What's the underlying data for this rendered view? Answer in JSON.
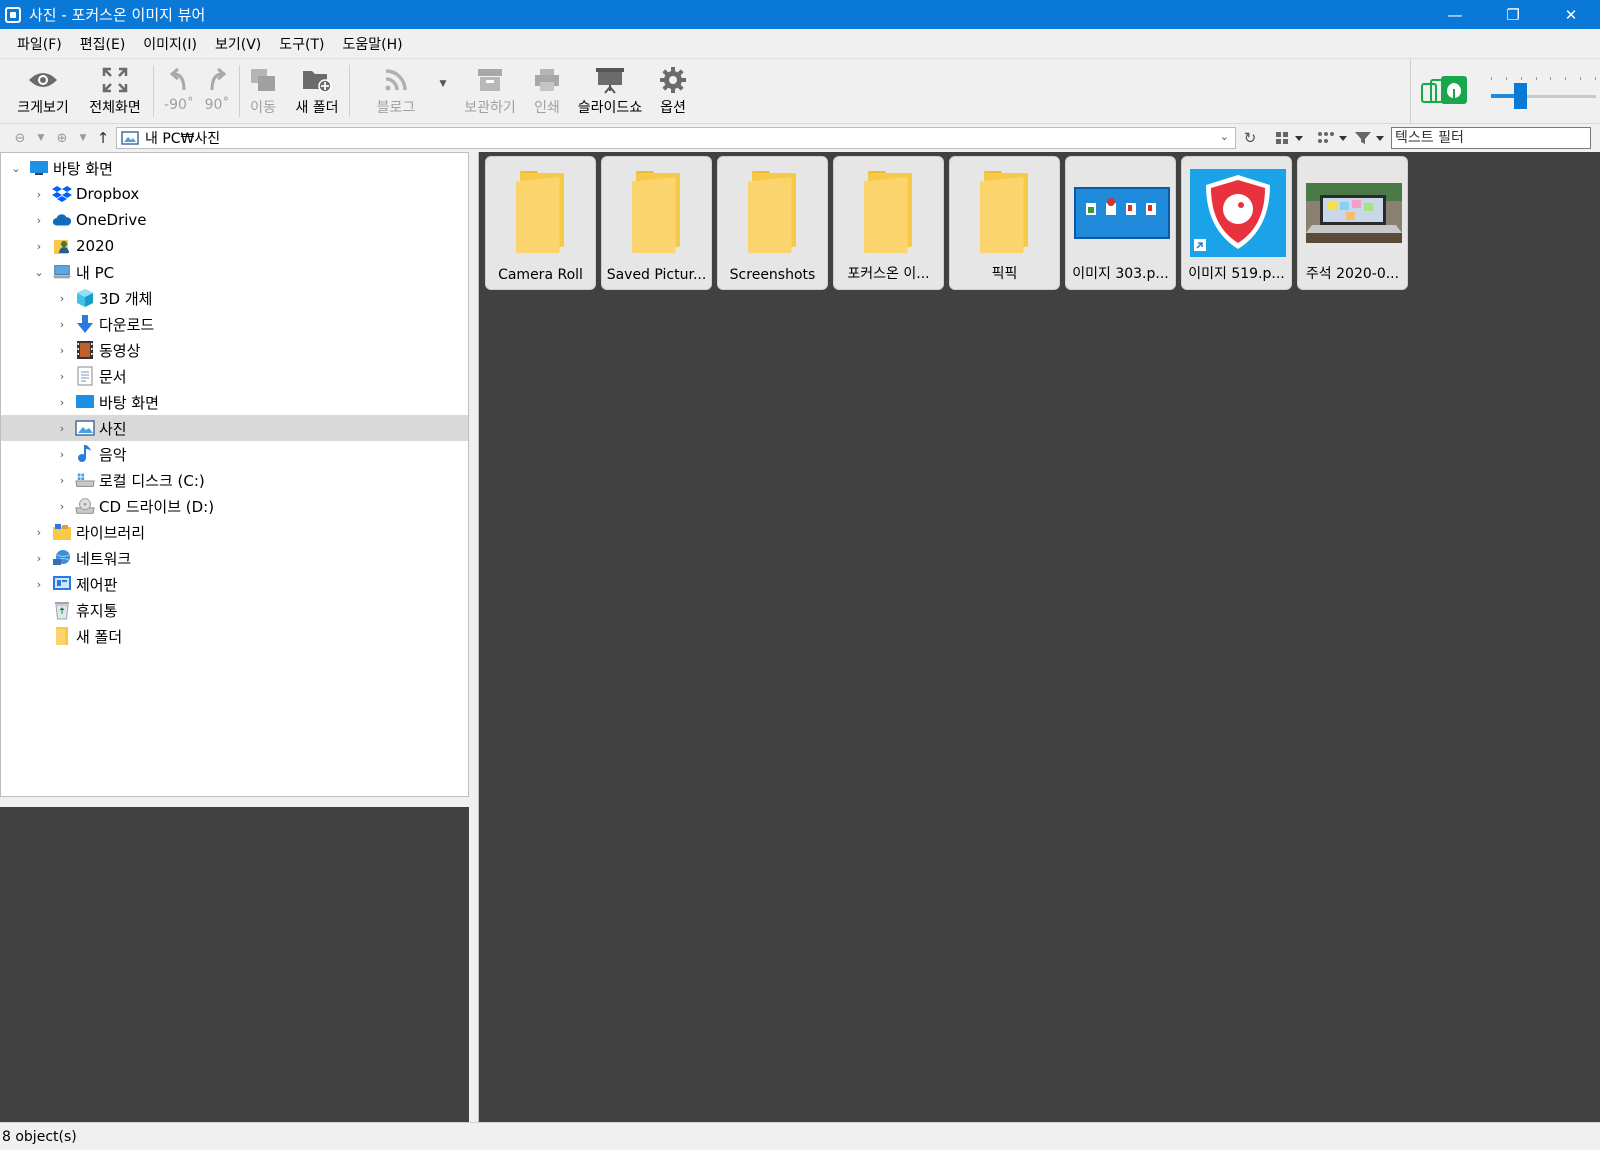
{
  "window": {
    "title": "사진 - 포커스온 이미지 뷰어",
    "minimize": "—",
    "maximize": "❐",
    "close": "✕"
  },
  "menu": [
    "파일(F)",
    "편집(E)",
    "이미지(I)",
    "보기(V)",
    "도구(T)",
    "도움말(H)"
  ],
  "toolbar": {
    "view_large": "크게보기",
    "fullscreen": "전체화면",
    "rotate_left": "-90˚",
    "rotate_right": "90˚",
    "move": "이동",
    "new_folder": "새 폴더",
    "blog": "블로그",
    "archive": "보관하기",
    "print": "인쇄",
    "slideshow": "슬라이드쇼",
    "options": "옵션"
  },
  "address": {
    "path": "내 PC₩사진",
    "filter_placeholder": "텍스트 필터"
  },
  "tree": [
    {
      "label": "바탕 화면",
      "level": 0,
      "expander": "⌄",
      "icon": "desktop-icon"
    },
    {
      "label": "Dropbox",
      "level": 1,
      "expander": "›",
      "icon": "dropbox-icon"
    },
    {
      "label": "OneDrive",
      "level": 1,
      "expander": "›",
      "icon": "onedrive-icon"
    },
    {
      "label": "2020",
      "level": 1,
      "expander": "›",
      "icon": "user-folder-icon"
    },
    {
      "label": "내 PC",
      "level": 1,
      "expander": "⌄",
      "icon": "pc-icon"
    },
    {
      "label": "3D 개체",
      "level": 2,
      "expander": "›",
      "icon": "3d-objects-icon"
    },
    {
      "label": "다운로드",
      "level": 2,
      "expander": "›",
      "icon": "download-icon"
    },
    {
      "label": "동영상",
      "level": 2,
      "expander": "›",
      "icon": "video-icon"
    },
    {
      "label": "문서",
      "level": 2,
      "expander": "›",
      "icon": "document-icon"
    },
    {
      "label": "바탕 화면",
      "level": 2,
      "expander": "›",
      "icon": "desktop-icon"
    },
    {
      "label": "사진",
      "level": 2,
      "expander": "›",
      "icon": "pictures-icon",
      "selected": true
    },
    {
      "label": "음악",
      "level": 2,
      "expander": "›",
      "icon": "music-icon"
    },
    {
      "label": "로컬 디스크 (C:)",
      "level": 2,
      "expander": "›",
      "icon": "disk-icon"
    },
    {
      "label": "CD 드라이브 (D:)",
      "level": 2,
      "expander": "›",
      "icon": "cd-drive-icon"
    },
    {
      "label": "라이브러리",
      "level": 1,
      "expander": "›",
      "icon": "library-icon"
    },
    {
      "label": "네트워크",
      "level": 1,
      "expander": "›",
      "icon": "network-icon"
    },
    {
      "label": "제어판",
      "level": 1,
      "expander": "›",
      "icon": "control-panel-icon"
    },
    {
      "label": "휴지통",
      "level": 1,
      "expander": "",
      "icon": "recycle-bin-icon"
    },
    {
      "label": "새 폴더",
      "level": 1,
      "expander": "",
      "icon": "folder-icon"
    }
  ],
  "items": [
    {
      "caption": "Camera Roll",
      "kind": "folder"
    },
    {
      "caption": "Saved Pictur...",
      "kind": "folder"
    },
    {
      "caption": "Screenshots",
      "kind": "folder"
    },
    {
      "caption": "포커스온 이...",
      "kind": "folder"
    },
    {
      "caption": "픽픽",
      "kind": "folder"
    },
    {
      "caption": "이미지 303.p...",
      "kind": "image-desktop"
    },
    {
      "caption": "이미지 519.p...",
      "kind": "image-shield"
    },
    {
      "caption": "주석 2020-0...",
      "kind": "image-laptop"
    }
  ],
  "status": {
    "text": "8 object(s)"
  },
  "colors": {
    "accent": "#0a78d7",
    "content_bg": "#414141",
    "selected_row": "#d9d9d9"
  }
}
